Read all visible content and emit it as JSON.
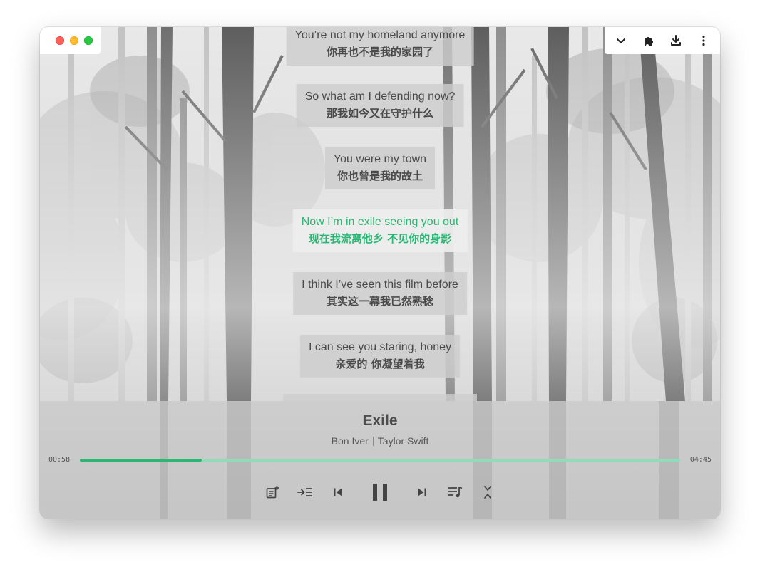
{
  "window": {
    "traffic_lights": [
      "close",
      "minimize",
      "zoom"
    ],
    "toolbar_icons": [
      "chevron-down-icon",
      "puzzle-icon",
      "download-icon",
      "more-vertical-icon"
    ]
  },
  "lyrics": [
    {
      "en": "You’re not my homeland anymore",
      "zh": "你再也不是我的家园了",
      "active": false
    },
    {
      "en": "So what am I defending now?",
      "zh": "那我如今又在守护什么",
      "active": false
    },
    {
      "en": "You were my town",
      "zh": "你也曾是我的故土",
      "active": false
    },
    {
      "en": "Now I’m in exile seeing you out",
      "zh": "现在我流离他乡 不见你的身影",
      "active": true
    },
    {
      "en": "I think I’ve seen this film before",
      "zh": "其实这一幕我已然熟稔",
      "active": false
    },
    {
      "en": "I can see you staring, honey",
      "zh": "亲爱的 你凝望着我",
      "active": false
    }
  ],
  "player": {
    "title": "Exile",
    "artist_1": "Bon Iver",
    "artist_2": "Taylor Swift",
    "current_time": "00:58",
    "total_time": "04:45",
    "progress": 0.203
  },
  "controls": [
    "add-to-playlist-icon",
    "play-next-icon",
    "previous-icon",
    "pause-icon",
    "next-icon",
    "queue-icon",
    "collapse-icon"
  ],
  "colors": {
    "accent": "#2bb673",
    "progress_track": "#8fdcbc",
    "close": "#ff5f57",
    "minimize": "#febc2e",
    "zoom": "#28c840"
  }
}
